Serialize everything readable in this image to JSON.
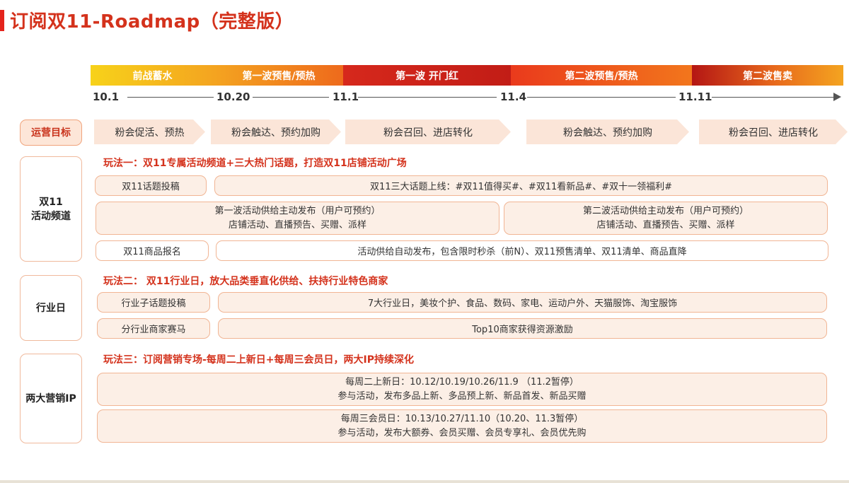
{
  "title": "订阅双11-Roadmap（完整版）",
  "phases": [
    {
      "label": "前战蓄水"
    },
    {
      "label": "第一波预售/预热"
    },
    {
      "label": "第一波 开门红"
    },
    {
      "label": "第二波预售/预热"
    },
    {
      "label": "第二波售卖"
    }
  ],
  "timeline": [
    "10.1",
    "10.20",
    "11.1",
    "11.4",
    "11.11"
  ],
  "goal": {
    "label": "运营目标",
    "items": [
      "粉会促活、预热",
      "粉会触达、预约加购",
      "粉会召回、进店转化",
      "粉会触达、预约加购",
      "粉会召回、进店转化"
    ]
  },
  "section1": {
    "side": [
      "双11",
      "活动频道"
    ],
    "head": "玩法一：双11专属活动频道+三大热门话题，打造双11店铺活动广场",
    "topic_label": "双11话题投稿",
    "topic_desc": "双11三大话题上线：#双11值得买#、#双11看新品#、#双十一领福利#",
    "wave1_title": "第一波活动供给主动发布（用户可预约）",
    "wave1_sub": "店铺活动、直播预告、买赠、派样",
    "wave2_title": "第二波活动供给主动发布（用户可预约）",
    "wave2_sub": "店铺活动、直播预告、买赠、派样",
    "goods_label": "双11商品报名",
    "goods_desc": "活动供给自动发布，包含限时秒杀（前N）、双11预售清单、双11清单、商品直降"
  },
  "section2": {
    "side": "行业日",
    "head": "玩法二： 双11行业日，放大品类垂直化供给、扶持行业特色商家",
    "sub_topic_label": "行业子话题投稿",
    "sub_topic_desc": "7大行业日，美妆个护、食品、数码、家电、运动户外、天猫服饰、淘宝服饰",
    "race_label": "分行业商家赛马",
    "race_desc": "Top10商家获得资源激励"
  },
  "section3": {
    "side": "两大营销IP",
    "head": "玩法三：订阅营销专场-每周二上新日+每周三会员日，两大IP持续深化",
    "tue_title": "每周二上新日：10.12/10.19/10.26/11.9 （11.2暂停）",
    "tue_sub": "参与活动，发布多品上新、多品预上新、新品首发、新品买赠",
    "wed_title": "每周三会员日：10.13/10.27/11.10（10.20、11.3暂停）",
    "wed_sub": "参与活动，发布大额券、会员买赠、会员专享礼、会员优先购"
  },
  "colors": {
    "accent": "#d4321c",
    "pill_fill": "#fcefe6",
    "pill_border": "#f1b594",
    "chevron_fill": "#fbe5d8"
  }
}
